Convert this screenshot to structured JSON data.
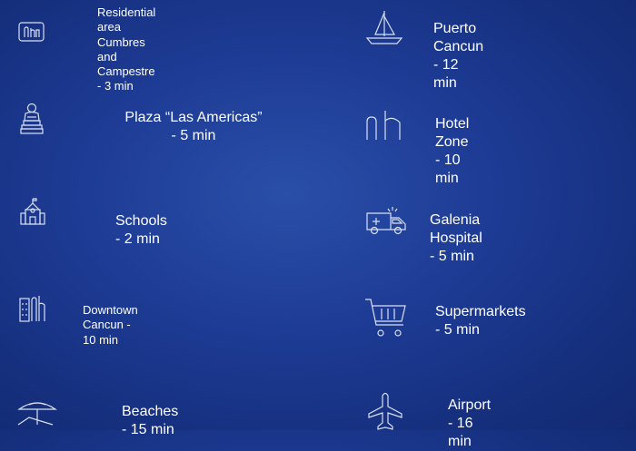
{
  "accent_color": "#1e3c96",
  "left_column": [
    {
      "icon": "residential-buildings-icon",
      "label_line1": "Residential area Cumbres",
      "label_line2": "and Campestre - 3 min"
    },
    {
      "icon": "plaza-statue-icon",
      "label_line1": "Plaza “Las Americas”",
      "label_line2": "- 5 min"
    },
    {
      "icon": "school-icon",
      "label": "Schools - 2 min"
    },
    {
      "icon": "downtown-buildings-icon",
      "label": "Downtown Cancun - 10 min"
    },
    {
      "icon": "beach-umbrella-icon",
      "label": "Beaches - 15 min"
    }
  ],
  "right_column": [
    {
      "icon": "sailboat-icon",
      "label": "Puerto Cancun - 12 min"
    },
    {
      "icon": "hotel-zone-icon",
      "label": "Hotel Zone - 10 min"
    },
    {
      "icon": "ambulance-icon",
      "label": "Galenia Hospital - 5 min"
    },
    {
      "icon": "shopping-cart-icon",
      "label": "Supermarkets - 5 min"
    },
    {
      "icon": "airplane-icon",
      "label": "Airport - 16 min"
    }
  ]
}
